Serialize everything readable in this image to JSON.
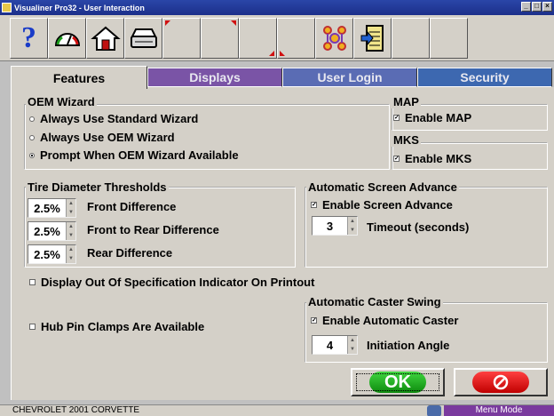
{
  "window": {
    "title": "Visualiner Pro32 - User Interaction",
    "controls": [
      "minimize",
      "maximize",
      "close"
    ]
  },
  "toolbar": {
    "buttons": [
      {
        "icon": "help-icon",
        "glyph": "?"
      },
      {
        "icon": "gauge-icon"
      },
      {
        "icon": "home-icon"
      },
      {
        "icon": "printer-icon"
      }
    ],
    "right_buttons": [
      {
        "icon": "vehicle-spec-icon"
      },
      {
        "icon": "notepad-icon"
      }
    ]
  },
  "tabs": [
    {
      "label": "Features",
      "active": true
    },
    {
      "label": "Displays",
      "active": false
    },
    {
      "label": "User Login",
      "active": false
    },
    {
      "label": "Security",
      "active": false
    }
  ],
  "oem_wizard": {
    "title": "OEM Wizard",
    "options": [
      {
        "label": "Always Use Standard Wizard",
        "selected": false
      },
      {
        "label": "Always Use OEM Wizard",
        "selected": false
      },
      {
        "label": "Prompt When OEM Wizard Available",
        "selected": true
      }
    ]
  },
  "map": {
    "title": "MAP",
    "option": {
      "label": "Enable MAP",
      "checked": true
    }
  },
  "mks": {
    "title": "MKS",
    "option": {
      "label": "Enable MKS",
      "checked": true
    }
  },
  "tire_thresholds": {
    "title": "Tire Diameter Thresholds",
    "rows": [
      {
        "value": "2.5%",
        "label": "Front Difference"
      },
      {
        "value": "2.5%",
        "label": "Front to Rear Difference"
      },
      {
        "value": "2.5%",
        "label": "Rear Difference"
      }
    ]
  },
  "screen_advance": {
    "title": "Automatic Screen Advance",
    "enable": {
      "label": "Enable Screen Advance",
      "checked": true
    },
    "timeout": {
      "value": "3",
      "label": "Timeout (seconds)"
    }
  },
  "display_out_of_spec": {
    "label": "Display Out Of Specification Indicator On Printout",
    "checked": false
  },
  "hub_pin_clamps": {
    "label": "Hub Pin Clamps Are Available",
    "checked": false
  },
  "caster_swing": {
    "title": "Automatic Caster Swing",
    "enable": {
      "label": "Enable Automatic Caster",
      "checked": true
    },
    "angle": {
      "value": "4",
      "label": "Initiation Angle"
    }
  },
  "buttons": {
    "ok_label": "OK"
  },
  "status": {
    "vehicle": "CHEVROLET 2001 CORVETTE",
    "mode": "Menu Mode"
  },
  "colors": {
    "tab_displays": "#7a54a6",
    "tab_user_login": "#5a6cb4",
    "tab_security": "#3d68b0",
    "ok_green": "#1fae1f",
    "cancel_red": "#e01010",
    "menu_mode_bg": "#7a3a9e"
  }
}
